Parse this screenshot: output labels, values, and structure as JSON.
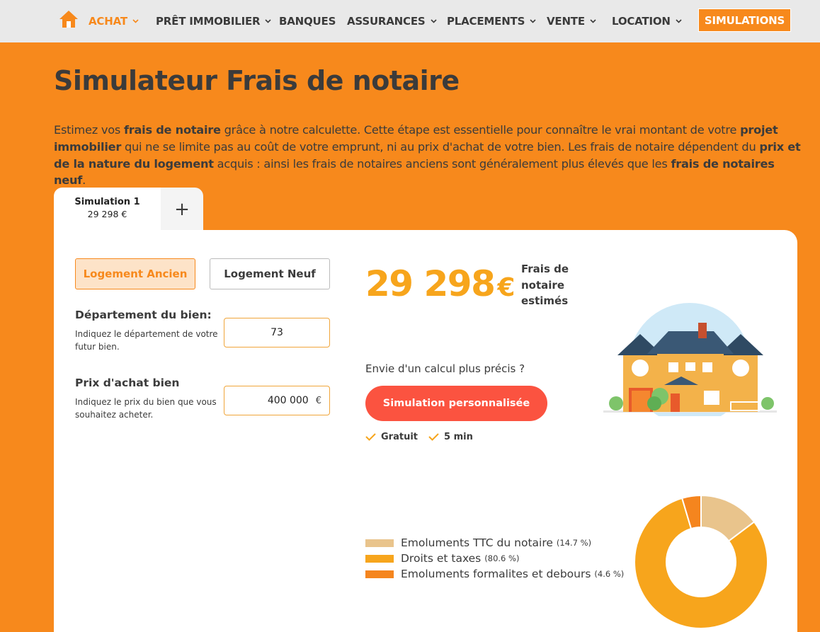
{
  "nav": {
    "items": [
      {
        "label": "ACHAT",
        "active": true,
        "dropdown": true
      },
      {
        "label": "PRÊT IMMOBILIER",
        "active": false,
        "dropdown": true
      },
      {
        "label": "BANQUES",
        "active": false,
        "dropdown": false
      },
      {
        "label": "ASSURANCES",
        "active": false,
        "dropdown": true
      },
      {
        "label": "PLACEMENTS",
        "active": false,
        "dropdown": true
      },
      {
        "label": "VENTE",
        "active": false,
        "dropdown": true
      },
      {
        "label": "LOCATION",
        "active": false,
        "dropdown": true
      }
    ],
    "cta": "SIMULATIONS",
    "home_icon": "home-icon"
  },
  "page": {
    "title": "Simulateur Frais de notaire",
    "intro": [
      {
        "text": "Estimez vos ",
        "bold": false
      },
      {
        "text": "frais de notaire",
        "bold": true
      },
      {
        "text": " grâce à notre calculette. Cette étape est essentielle pour connaître le vrai montant de votre ",
        "bold": false
      },
      {
        "text": "projet immobilier",
        "bold": true
      },
      {
        "text": " qui ne se limite pas au coût de votre emprunt, ni au prix d'achat de votre bien. Les frais de notaire dépendent du ",
        "bold": false
      },
      {
        "text": "prix et de la nature du logement",
        "bold": true
      },
      {
        "text": " acquis : ainsi les frais de notaires anciens sont généralement plus élevés que les ",
        "bold": false
      },
      {
        "text": "frais de notaires neuf",
        "bold": true
      },
      {
        "text": ".",
        "bold": false
      }
    ]
  },
  "tabs": {
    "active_name": "Simulation 1",
    "active_value": "29 298 €",
    "add_label": "+"
  },
  "form": {
    "type_ancien": "Logement Ancien",
    "type_neuf": "Logement Neuf",
    "selected_type": "Logement Ancien",
    "departement_label": "Département du bien:",
    "departement_help": "Indiquez le département de votre futur bien.",
    "departement_value": "73",
    "prix_label": "Prix d'achat bien",
    "prix_help": "Indiquez le prix du bien que vous souhaitez acheter.",
    "prix_value": "400 000",
    "prix_unit": "€"
  },
  "result": {
    "amount": "29 298",
    "currency": "€",
    "label": "Frais de notaire estimés",
    "cta_question": "Envie d'un calcul plus précis ?",
    "cta_button": "Simulation personnalisée",
    "perks": [
      "Gratuit",
      "5 min"
    ]
  },
  "colors": {
    "brand_orange": "#f7891c",
    "result_orange": "#f7a51c",
    "cta_red": "#fb5340"
  },
  "chart_data": {
    "type": "pie",
    "categories": [
      "Emoluments TTC du notaire",
      "Droits et taxes",
      "Emoluments formalites et debours"
    ],
    "values": [
      14.7,
      80.6,
      4.6
    ],
    "labels": [
      "(14.7 %)",
      "(80.6 %)",
      "(4.6 %)"
    ],
    "colors": [
      "#e9c48c",
      "#f7a51c",
      "#f5851e"
    ],
    "donut": true,
    "legend": "left"
  }
}
